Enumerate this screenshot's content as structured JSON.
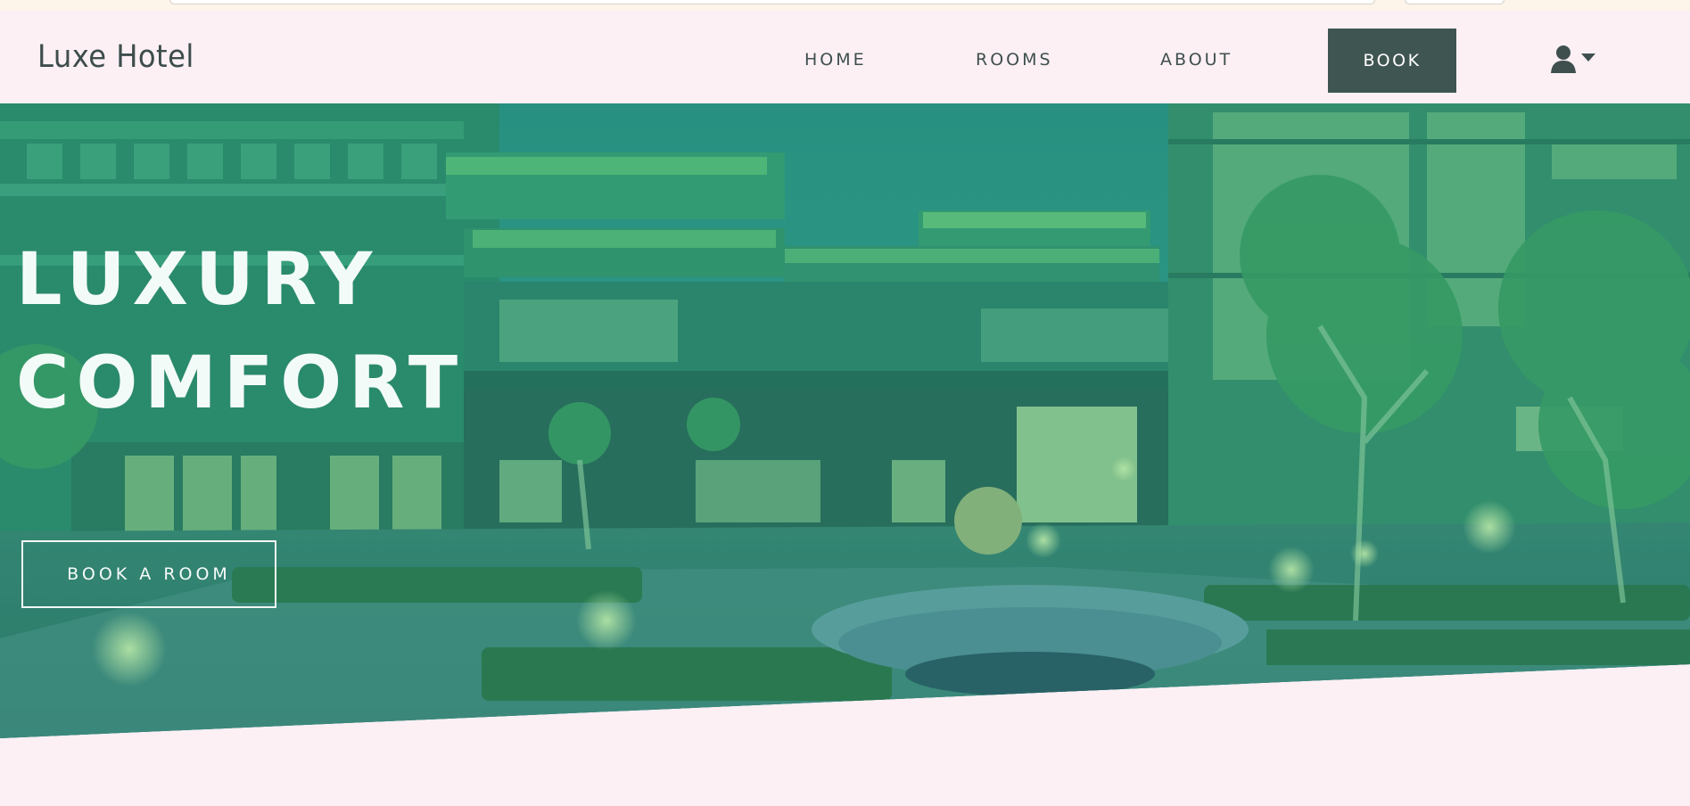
{
  "brand": {
    "name": "Luxe Hotel"
  },
  "nav": {
    "links": [
      "HOME",
      "ROOMS",
      "ABOUT"
    ],
    "book_label": "BOOK"
  },
  "user_menu": {
    "icon": "user-icon",
    "caret": "caret-down-icon"
  },
  "hero": {
    "title_line1": "LUXURY",
    "title_line2": "COMFORT",
    "cta_label": "BOOK A ROOM"
  },
  "colors": {
    "page_bg": "#fcf0f5",
    "nav_text": "#3f4f4d",
    "book_button_bg": "#3f5551",
    "hero_overlay": "#1f9c7e",
    "hero_text": "#f3fbf8"
  }
}
